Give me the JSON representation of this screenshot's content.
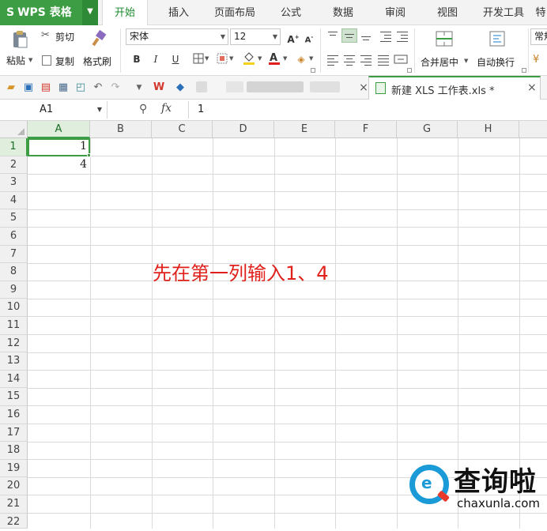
{
  "app": {
    "name": "WPS 表格"
  },
  "menu": {
    "tabs": [
      {
        "label": "开始",
        "active": true
      },
      {
        "label": "插入"
      },
      {
        "label": "页面布局"
      },
      {
        "label": "公式"
      },
      {
        "label": "数据"
      },
      {
        "label": "审阅"
      },
      {
        "label": "视图"
      },
      {
        "label": "开发工具"
      },
      {
        "label": "特"
      }
    ]
  },
  "ribbon": {
    "paste": "粘贴",
    "cut": "剪切",
    "copy": "复制",
    "format_painter": "格式刷",
    "font_name": "宋体",
    "font_size": "12",
    "bold": "B",
    "italic": "I",
    "underline": "U",
    "merge_center": "合并居中",
    "wrap_text": "自动换行",
    "number_format": "常规"
  },
  "doc_tab": {
    "name": "新建 XLS 工作表.xls *"
  },
  "formula_bar": {
    "name_box": "A1",
    "fx": "fx",
    "value": "1"
  },
  "sheet": {
    "columns": [
      "A",
      "B",
      "C",
      "D",
      "E",
      "F",
      "G",
      "H"
    ],
    "rows": [
      "1",
      "2",
      "3",
      "4",
      "5",
      "6",
      "7",
      "8",
      "9",
      "10",
      "11",
      "12",
      "13",
      "14",
      "15",
      "16",
      "17",
      "18",
      "19",
      "20",
      "21",
      "22"
    ],
    "active_cell": "A1",
    "cells": {
      "A1": "1",
      "A2": "4"
    }
  },
  "annotation": "先在第一列输入1、4",
  "watermark": {
    "title": "查询啦",
    "url": "chaxunla.com"
  },
  "colors": {
    "accent": "#3d9d44",
    "annotation": "#e0211b",
    "watermark_blue": "#1a9ad7"
  }
}
